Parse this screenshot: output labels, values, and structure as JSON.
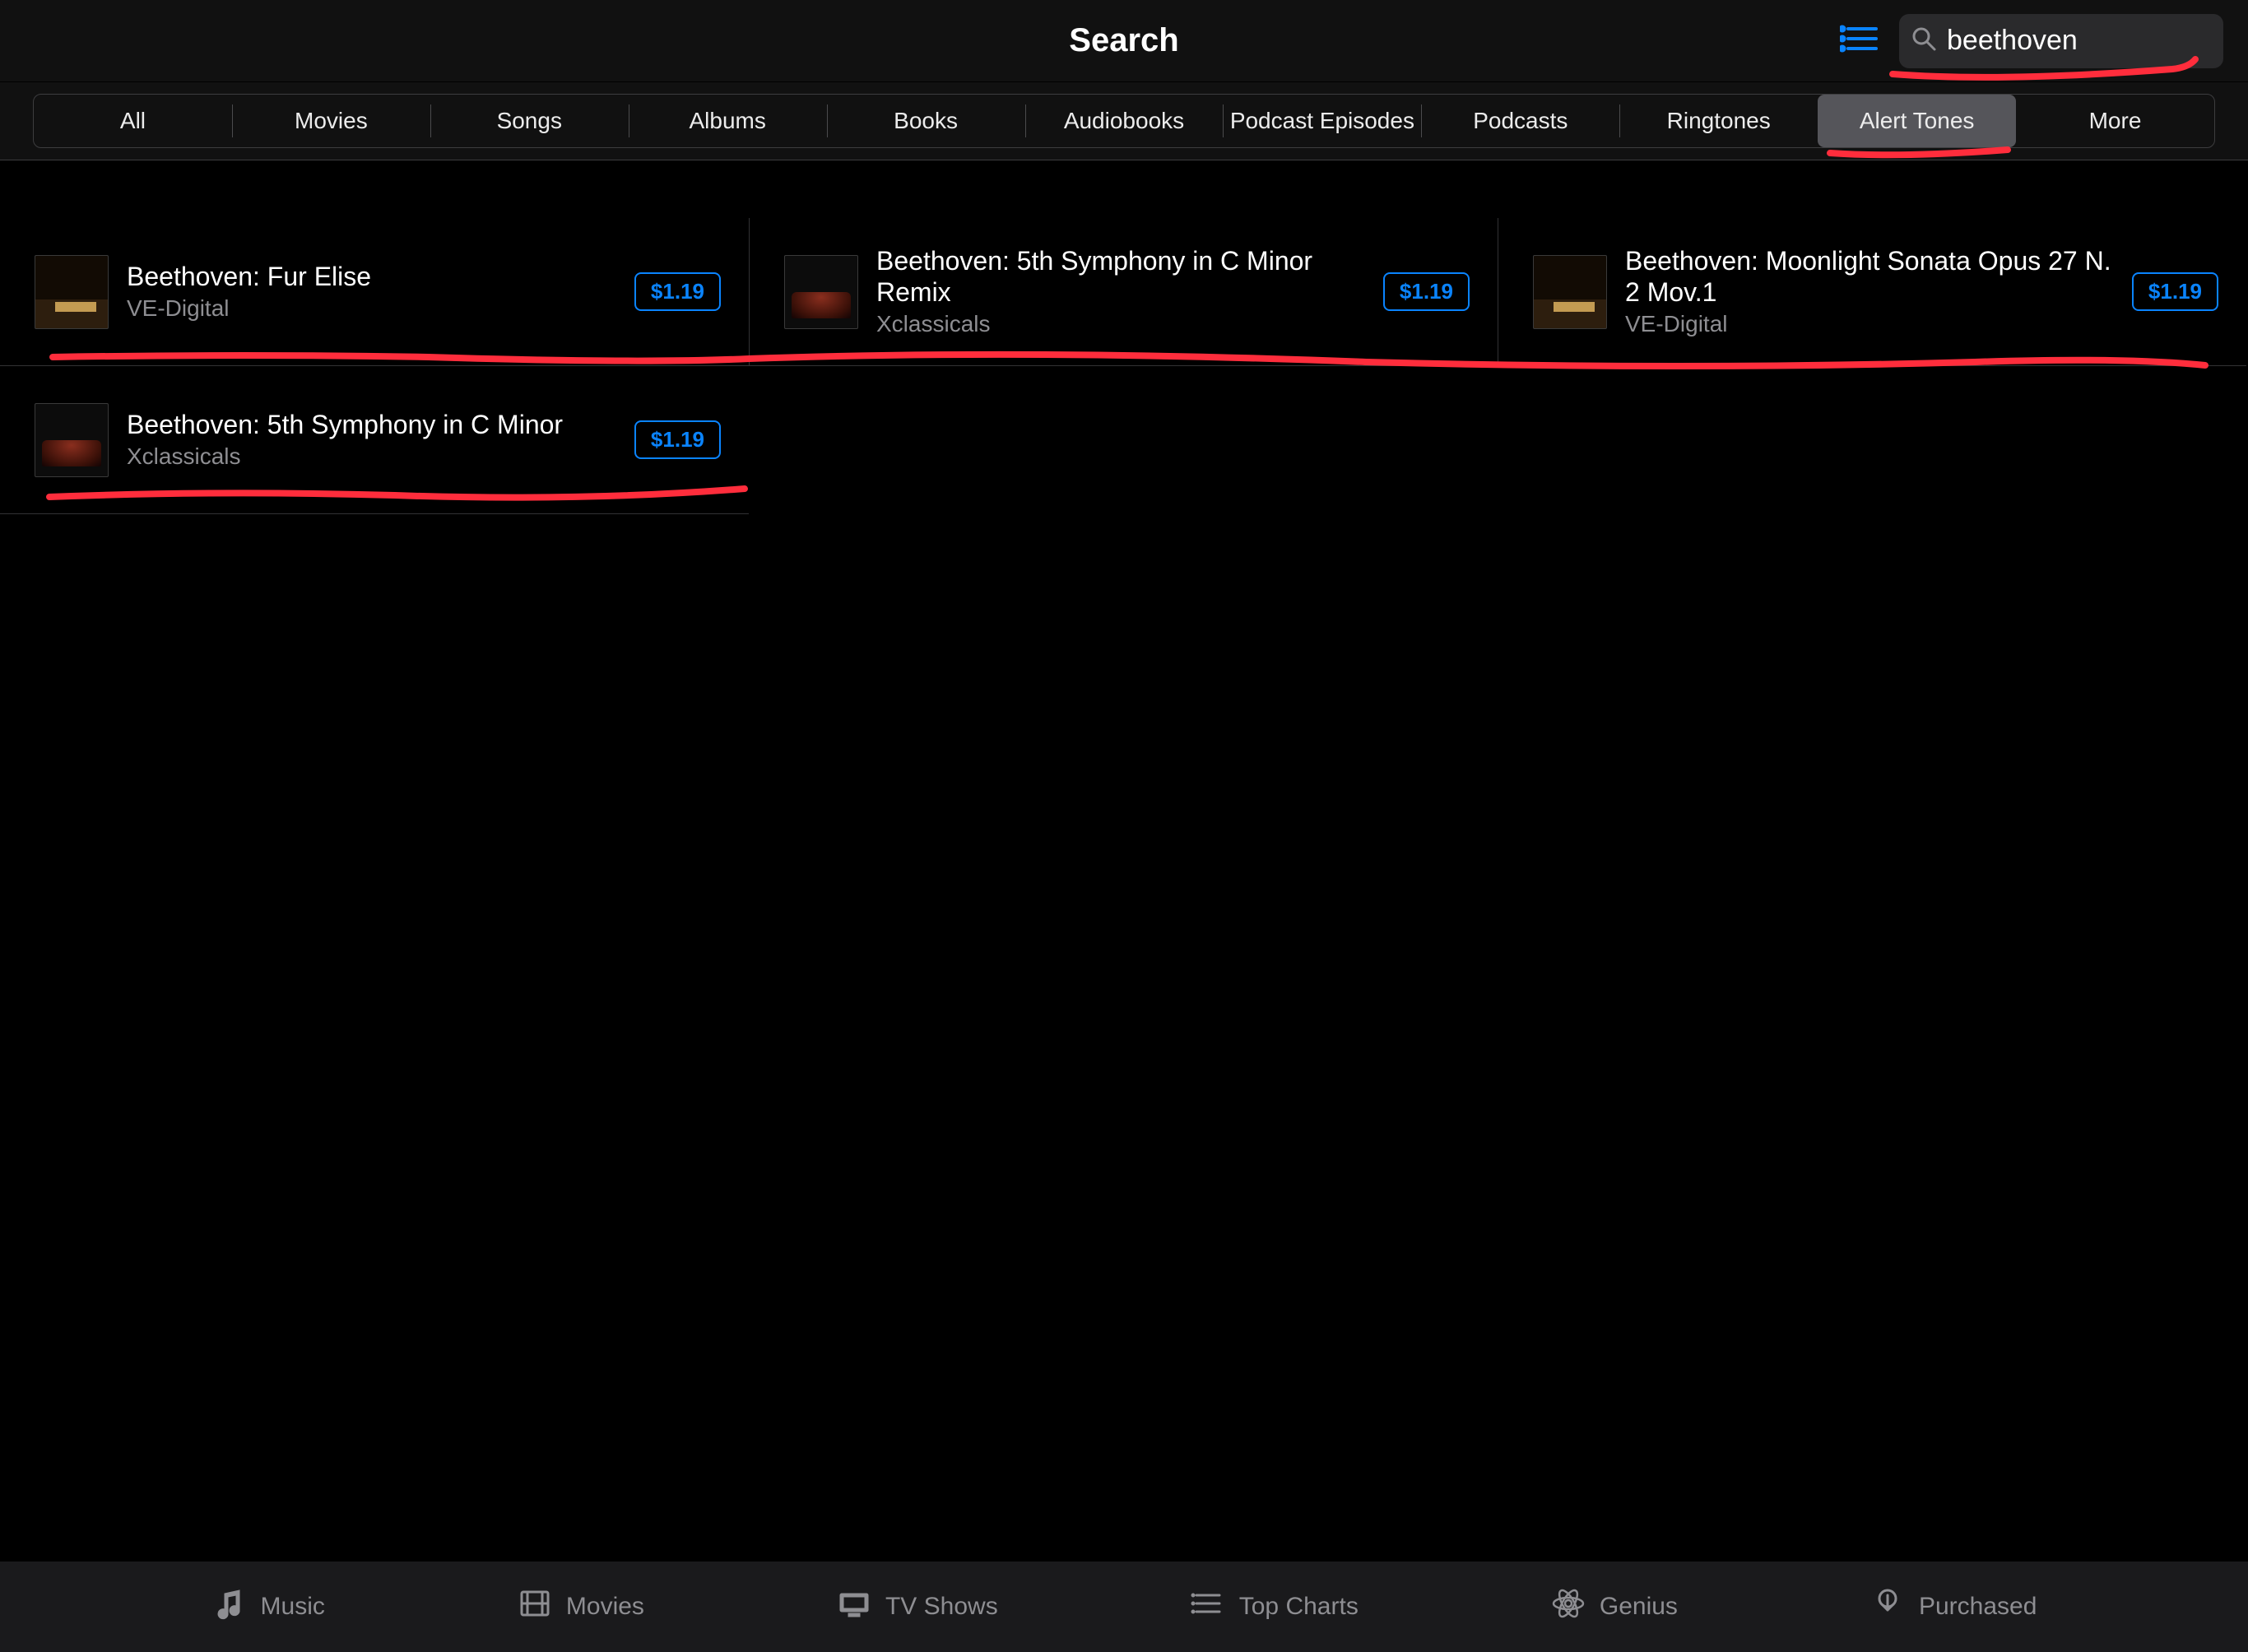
{
  "nav": {
    "title": "Search"
  },
  "search": {
    "query": "beethoven"
  },
  "categories": [
    {
      "label": "All",
      "active": false
    },
    {
      "label": "Movies",
      "active": false
    },
    {
      "label": "Songs",
      "active": false
    },
    {
      "label": "Albums",
      "active": false
    },
    {
      "label": "Books",
      "active": false
    },
    {
      "label": "Audiobooks",
      "active": false
    },
    {
      "label": "Podcast Episodes",
      "active": false
    },
    {
      "label": "Podcasts",
      "active": false
    },
    {
      "label": "Ringtones",
      "active": false
    },
    {
      "label": "Alert Tones",
      "active": true
    },
    {
      "label": "More",
      "active": false
    }
  ],
  "results": [
    {
      "title": "Beethoven: Fur Elise",
      "artist": "VE-Digital",
      "price": "$1.19",
      "art": "piano"
    },
    {
      "title": "Beethoven: 5th Symphony in C Minor Remix",
      "artist": "Xclassicals",
      "price": "$1.19",
      "art": "orch"
    },
    {
      "title": "Beethoven: Moonlight Sonata Opus 27 N. 2 Mov.1",
      "artist": "VE-Digital",
      "price": "$1.19",
      "art": "piano"
    },
    {
      "title": "Beethoven: 5th Symphony in C Minor",
      "artist": "Xclassicals",
      "price": "$1.19",
      "art": "orch"
    }
  ],
  "tabs": [
    {
      "label": "Music",
      "icon": "music"
    },
    {
      "label": "Movies",
      "icon": "film"
    },
    {
      "label": "TV Shows",
      "icon": "tv"
    },
    {
      "label": "Top Charts",
      "icon": "charts"
    },
    {
      "label": "Genius",
      "icon": "genius"
    },
    {
      "label": "Purchased",
      "icon": "purchased"
    }
  ],
  "accent": "#0a84ff"
}
